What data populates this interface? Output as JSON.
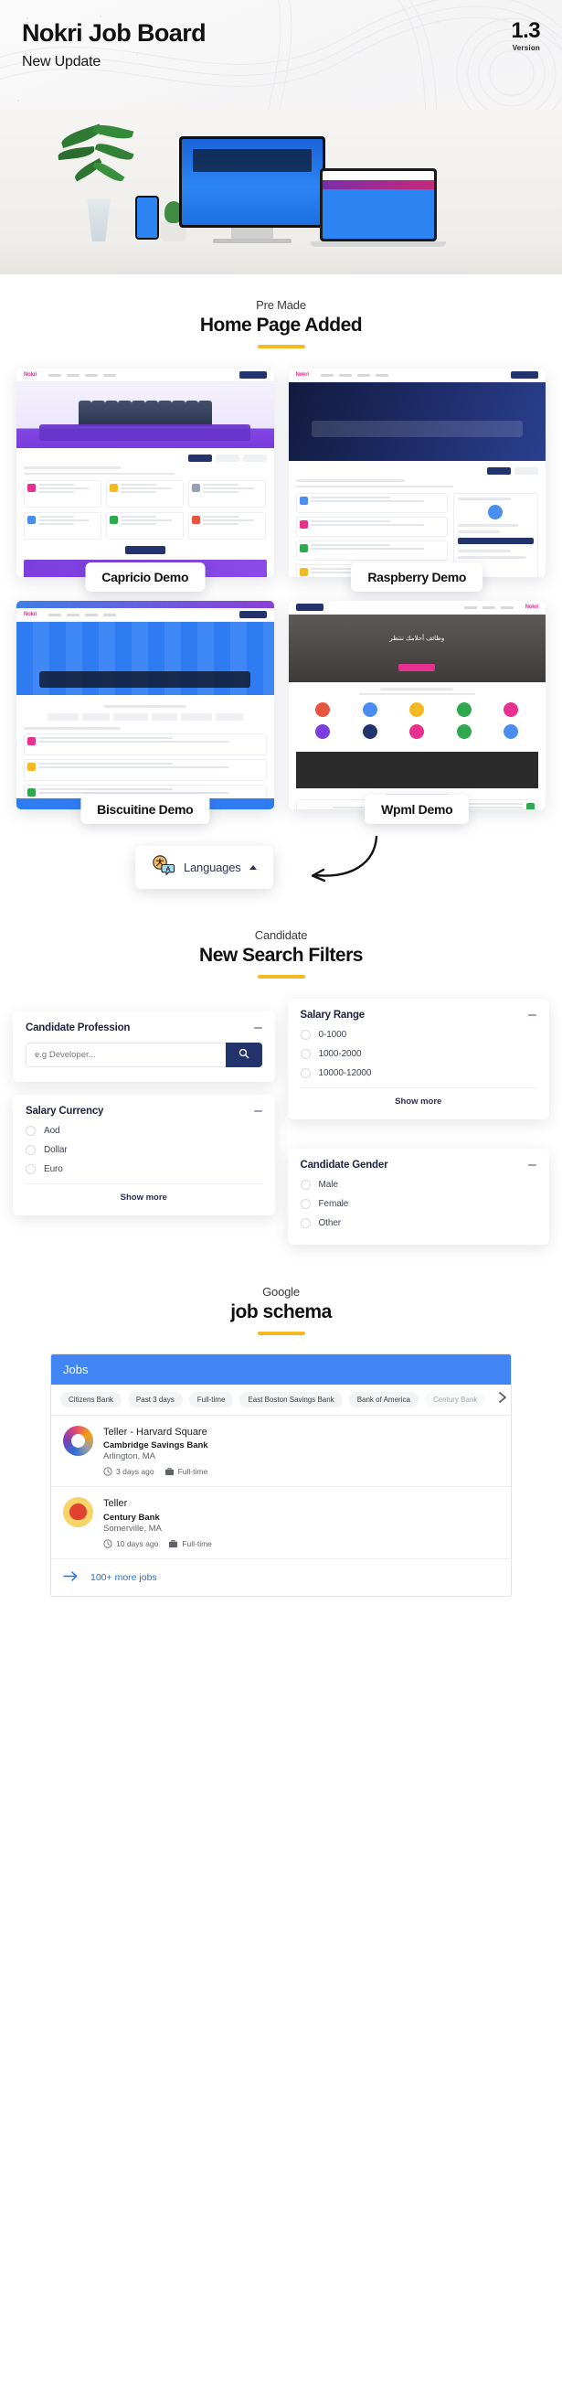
{
  "hero": {
    "title": "Nokri Job Board",
    "subtitle": "New Update",
    "version_number": "1.3",
    "version_label": "Version"
  },
  "home_section": {
    "eyebrow": "Pre Made",
    "title": "Home Page Added",
    "demos": [
      {
        "label": "Capricio Demo"
      },
      {
        "label": "Raspberry Demo"
      },
      {
        "label": "Biscuitine Demo"
      },
      {
        "label": "Wpml Demo"
      }
    ]
  },
  "languages": {
    "label": "Languages",
    "icon": "translate-icon",
    "caret": "caret-up-icon"
  },
  "filters_section": {
    "eyebrow": "Candidate",
    "title": "New Search Filters",
    "cards": [
      {
        "title": "Candidate Profession",
        "type": "search",
        "placeholder": "e.g Developer...",
        "value": "",
        "search_icon": "search-icon",
        "collapse_icon": "minus-icon"
      },
      {
        "title": "Salary Range",
        "type": "radio",
        "options": [
          "0-1000",
          "1000-2000",
          "10000-12000"
        ],
        "show_more": "Show more",
        "collapse_icon": "minus-icon"
      },
      {
        "title": "Salary Currency",
        "type": "radio",
        "options": [
          "Aod",
          "Dollar",
          "Euro"
        ],
        "show_more": "Show more",
        "collapse_icon": "minus-icon"
      },
      {
        "title": "Candidate Gender",
        "type": "radio",
        "options": [
          "Male",
          "Female",
          "Other"
        ],
        "collapse_icon": "minus-icon"
      }
    ]
  },
  "schema_section": {
    "eyebrow": "Google",
    "title": "job schema"
  },
  "google_jobs": {
    "header": "Jobs",
    "header_color": "#4285f4",
    "chips": [
      {
        "label": "Citizens Bank",
        "faded": false
      },
      {
        "label": "Past 3 days",
        "faded": false
      },
      {
        "label": "Full-time",
        "faded": false
      },
      {
        "label": "East Boston Savings Bank",
        "faded": false
      },
      {
        "label": "Bank of America",
        "faded": false
      },
      {
        "label": "Century Bank",
        "faded": true
      }
    ],
    "next_icon": "chevron-right-icon",
    "listings": [
      {
        "title": "Teller - Harvard Square",
        "company": "Cambridge Savings Bank",
        "location": "Arlington, MA",
        "posted": "3 days ago",
        "employment_type": "Full-time",
        "logo": "cambridge-savings-bank-logo",
        "clock_icon": "clock-icon",
        "briefcase_icon": "briefcase-icon"
      },
      {
        "title": "Teller",
        "company": "Century Bank",
        "location": "Somerville, MA",
        "posted": "10 days ago",
        "employment_type": "Full-time",
        "logo": "century-bank-logo",
        "clock_icon": "clock-icon",
        "briefcase_icon": "briefcase-icon"
      }
    ],
    "more_label": "100+ more jobs",
    "more_icon": "arrow-right-icon"
  },
  "colors": {
    "accent_yellow": "#f5b924",
    "navy": "#22346b",
    "google_blue": "#4285f4",
    "link_blue": "#1a73e8",
    "pink": "#e7308f"
  }
}
